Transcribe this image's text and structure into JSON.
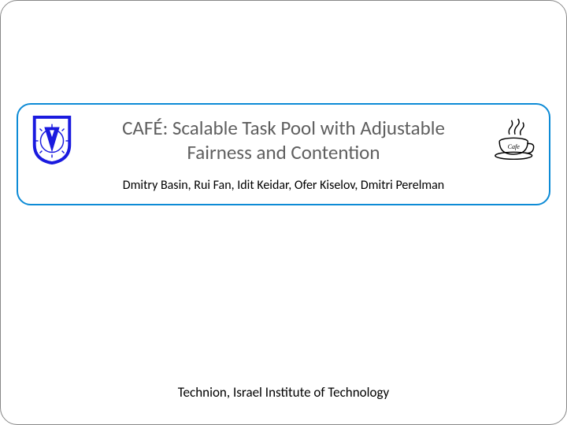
{
  "slide": {
    "title_line1": "CAFÉ: Scalable Task Pool with Adjustable",
    "title_line2": "Fairness and Contention",
    "authors": "Dmitry Basin, Rui Fan, Idit Keidar, Ofer Kiselov, Dmitri Perelman",
    "affiliation": "Technion,  Israel Institute of Technology"
  },
  "icons": {
    "left_logo": "technion-shield-logo",
    "right_logo": "cafe-cup-logo"
  },
  "colors": {
    "accent": "#0d8bd6",
    "shield_blue": "#1a1adf",
    "title_text": "#5f5f5f"
  }
}
